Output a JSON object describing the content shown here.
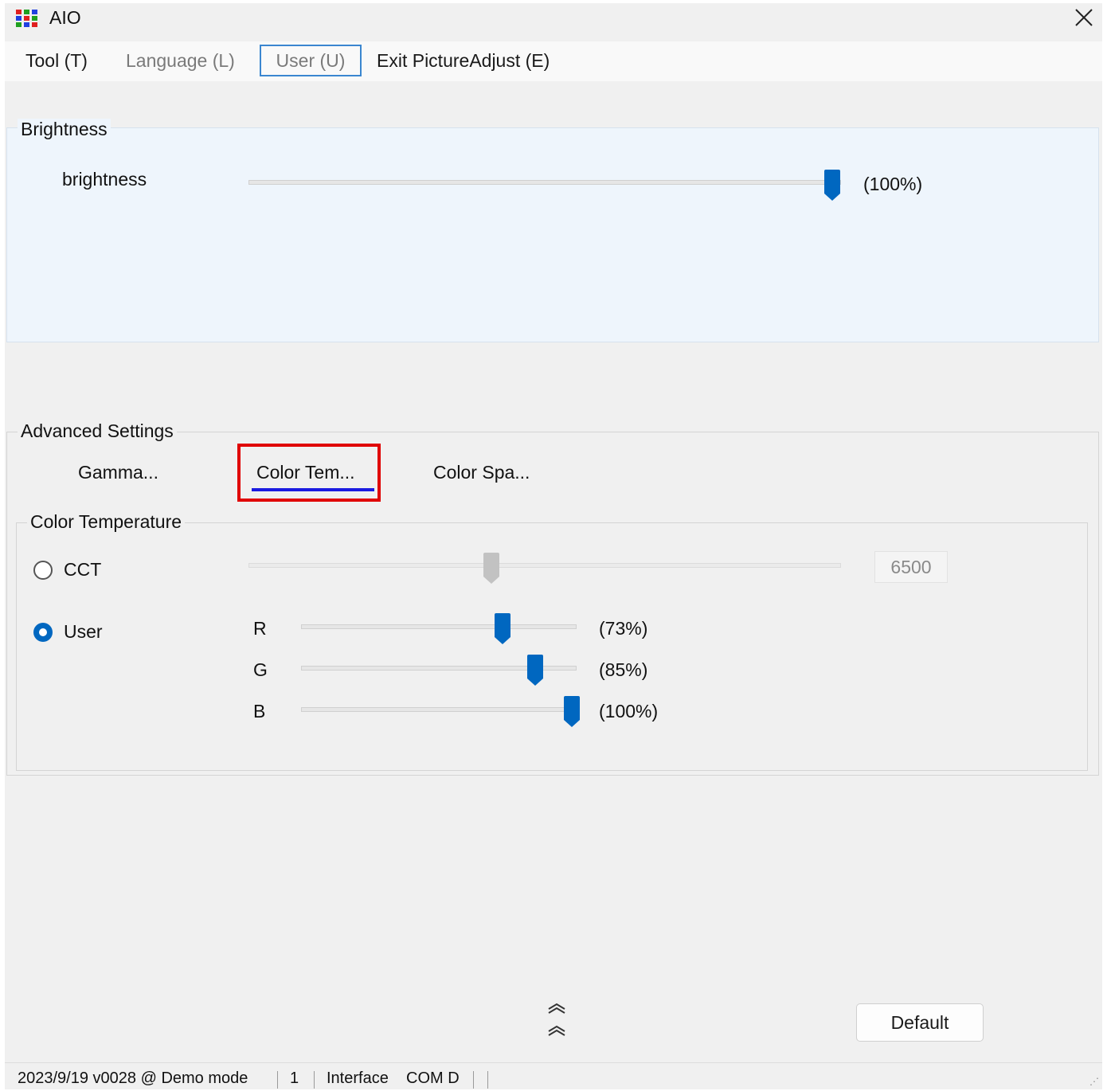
{
  "window": {
    "title": "AIO",
    "close_icon": "close-icon",
    "app_icon": "rgb-grid-icon"
  },
  "menu": {
    "items": [
      "Tool (T)",
      "Language (L)",
      "User (U)",
      "Exit PictureAdjust (E)"
    ]
  },
  "brightness_group": {
    "title": "Brightness",
    "label": "brightness",
    "value_text": "(100%)",
    "value": 100
  },
  "advanced": {
    "title": "Advanced Settings",
    "tabs": [
      "Gamma...",
      "Color Tem...",
      "Color Spa..."
    ],
    "active_tab": "Color Tem..."
  },
  "color_temperature": {
    "title": "Color Temperature",
    "cct_label": "CCT",
    "cct_value": "6500",
    "cct_slider_fraction": 0.41,
    "cct_selected": false,
    "user_label": "User",
    "user_selected": true,
    "channels": [
      {
        "name": "R",
        "value_text": "(73%)",
        "value": 73
      },
      {
        "name": "G",
        "value_text": "(85%)",
        "value": 85
      },
      {
        "name": "B",
        "value_text": "(100%)",
        "value": 100
      }
    ]
  },
  "buttons": {
    "default": "Default"
  },
  "statusbar": {
    "version": "2023/9/19 v0028 @ Demo mode",
    "count": "1",
    "interface_label": "Interface",
    "interface_value": "COM D"
  },
  "colors": {
    "accent": "#0067c0",
    "highlight": "#e00000",
    "tab_underline": "#1a1ae0",
    "brightness_panel": "#eef5fc"
  }
}
